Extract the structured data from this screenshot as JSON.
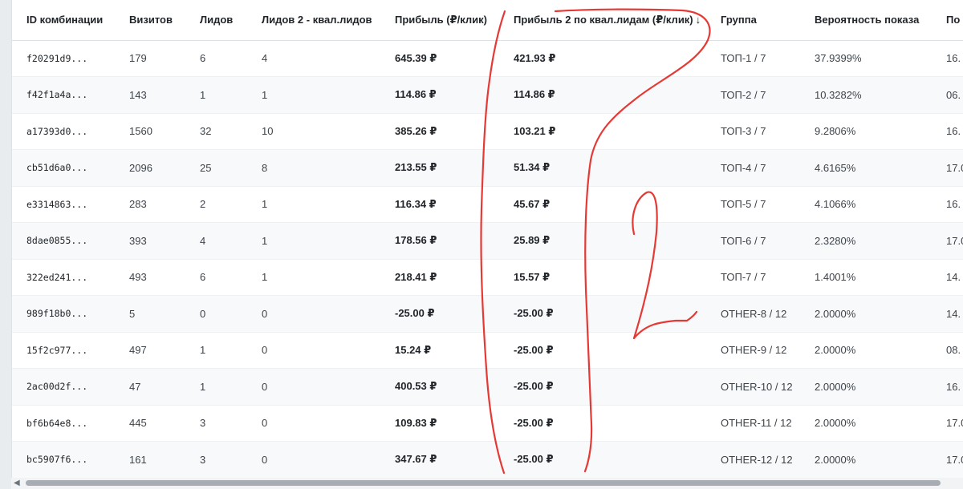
{
  "table": {
    "columns": [
      {
        "key": "id",
        "label": "ID комбинации"
      },
      {
        "key": "visits",
        "label": "Визитов"
      },
      {
        "key": "leads",
        "label": "Лидов"
      },
      {
        "key": "leads2",
        "label": "Лидов 2 - квал.лидов"
      },
      {
        "key": "profit",
        "label": "Прибыль (₽/клик)"
      },
      {
        "key": "profit2",
        "label": "Прибыль 2 по квал.лидам (₽/клик)"
      },
      {
        "key": "group",
        "label": "Группа"
      },
      {
        "key": "prob",
        "label": "Вероятность показа"
      },
      {
        "key": "last",
        "label": "По"
      }
    ],
    "sort_indicator": "↓",
    "rows": [
      {
        "id": "f20291d9...",
        "visits": "179",
        "leads": "6",
        "leads2": "4",
        "profit": "645.39 ₽",
        "profit2": "421.93 ₽",
        "group": "ТОП-1 / 7",
        "prob": "37.9399%",
        "last": "16."
      },
      {
        "id": "f42f1a4a...",
        "visits": "143",
        "leads": "1",
        "leads2": "1",
        "profit": "114.86 ₽",
        "profit2": "114.86 ₽",
        "group": "ТОП-2 / 7",
        "prob": "10.3282%",
        "last": "06."
      },
      {
        "id": "a17393d0...",
        "visits": "1560",
        "leads": "32",
        "leads2": "10",
        "profit": "385.26 ₽",
        "profit2": "103.21 ₽",
        "group": "ТОП-3 / 7",
        "prob": "9.2806%",
        "last": "16."
      },
      {
        "id": "cb51d6a0...",
        "visits": "2096",
        "leads": "25",
        "leads2": "8",
        "profit": "213.55 ₽",
        "profit2": "51.34 ₽",
        "group": "ТОП-4 / 7",
        "prob": "4.6165%",
        "last": "17.0"
      },
      {
        "id": "e3314863...",
        "visits": "283",
        "leads": "2",
        "leads2": "1",
        "profit": "116.34 ₽",
        "profit2": "45.67 ₽",
        "group": "ТОП-5 / 7",
        "prob": "4.1066%",
        "last": "16."
      },
      {
        "id": "8dae0855...",
        "visits": "393",
        "leads": "4",
        "leads2": "1",
        "profit": "178.56 ₽",
        "profit2": "25.89 ₽",
        "group": "ТОП-6 / 7",
        "prob": "2.3280%",
        "last": "17.0"
      },
      {
        "id": "322ed241...",
        "visits": "493",
        "leads": "6",
        "leads2": "1",
        "profit": "218.41 ₽",
        "profit2": "15.57 ₽",
        "group": "ТОП-7 / 7",
        "prob": "1.4001%",
        "last": "14."
      },
      {
        "id": "989f18b0...",
        "visits": "5",
        "leads": "0",
        "leads2": "0",
        "profit": "-25.00 ₽",
        "profit2": "-25.00 ₽",
        "group": "OTHER-8 / 12",
        "prob": "2.0000%",
        "last": "14."
      },
      {
        "id": "15f2c977...",
        "visits": "497",
        "leads": "1",
        "leads2": "0",
        "profit": "15.24 ₽",
        "profit2": "-25.00 ₽",
        "group": "OTHER-9 / 12",
        "prob": "2.0000%",
        "last": "08."
      },
      {
        "id": "2ac00d2f...",
        "visits": "47",
        "leads": "1",
        "leads2": "0",
        "profit": "400.53 ₽",
        "profit2": "-25.00 ₽",
        "group": "OTHER-10 / 12",
        "prob": "2.0000%",
        "last": "16."
      },
      {
        "id": "bf6b64e8...",
        "visits": "445",
        "leads": "3",
        "leads2": "0",
        "profit": "109.83 ₽",
        "profit2": "-25.00 ₽",
        "group": "OTHER-11 / 12",
        "prob": "2.0000%",
        "last": "17.0"
      },
      {
        "id": "bc5907f6...",
        "visits": "161",
        "leads": "3",
        "leads2": "0",
        "profit": "347.67 ₽",
        "profit2": "-25.00 ₽",
        "group": "OTHER-12 / 12",
        "prob": "2.0000%",
        "last": "17.0"
      }
    ]
  },
  "scrollbar": {
    "left_arrow_icon": "chevron-left-icon"
  },
  "annotation": {
    "color": "#e53935",
    "icon": "red-handwritten-annotation-icon"
  }
}
